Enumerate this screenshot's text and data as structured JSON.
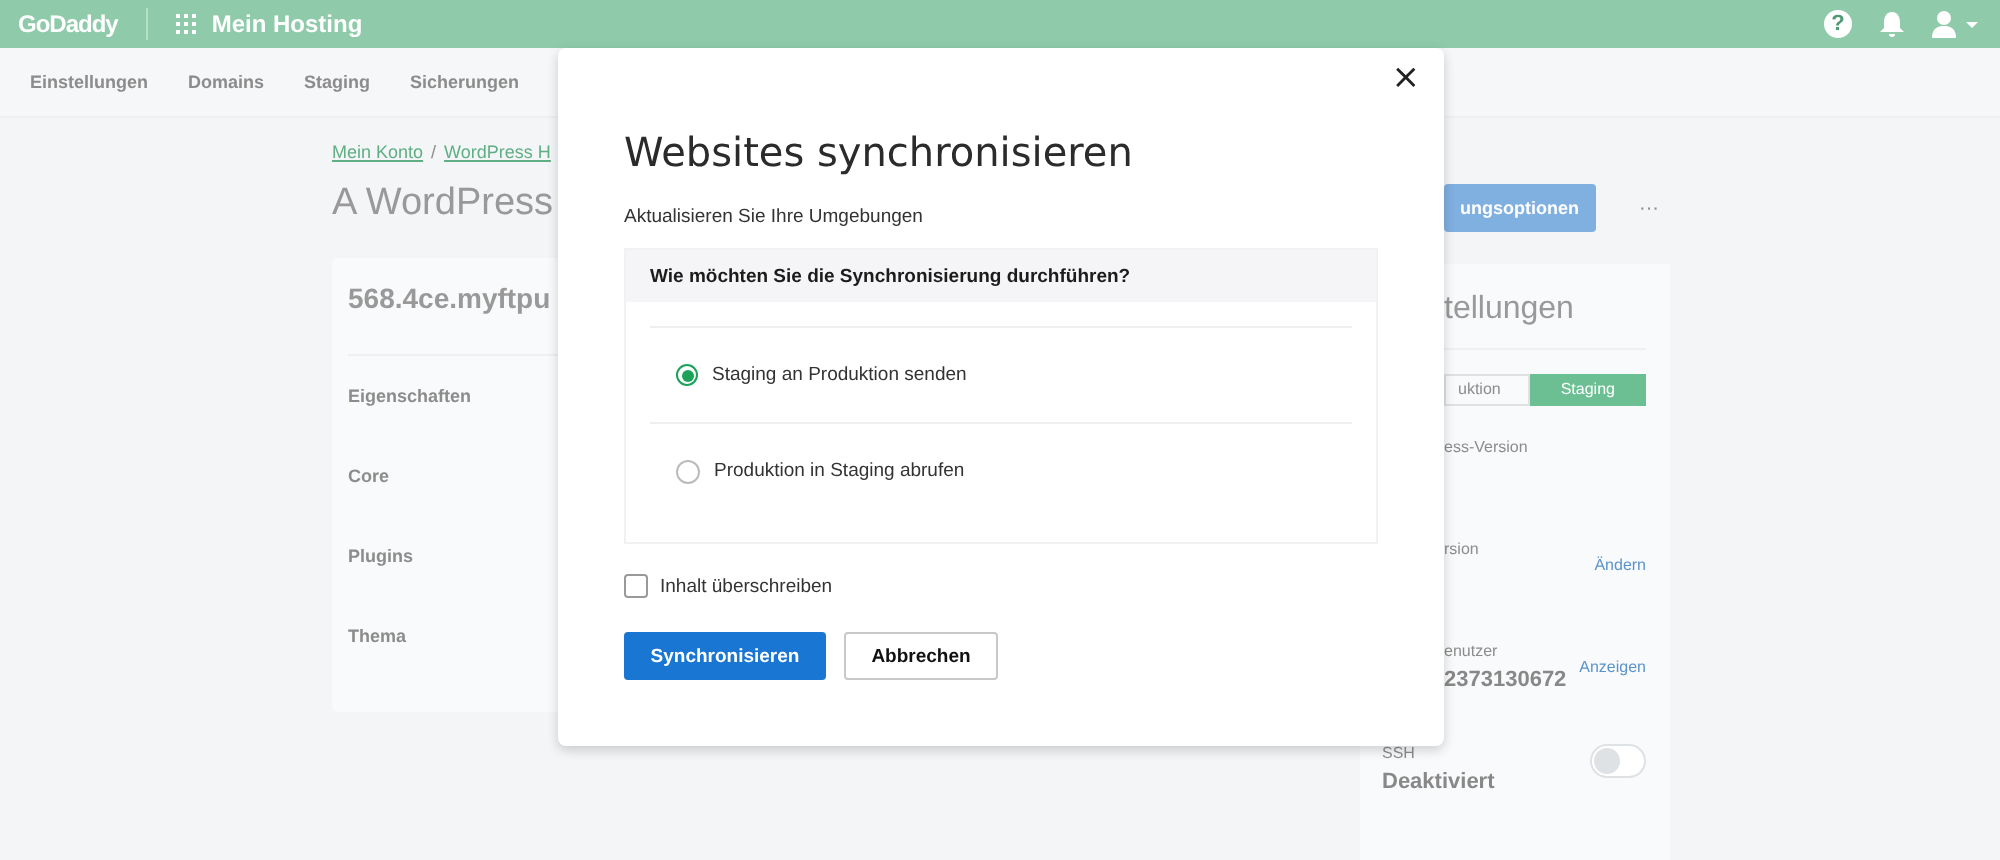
{
  "header": {
    "logo": "GoDaddy",
    "app_title": "Mein Hosting",
    "help": "?"
  },
  "nav": {
    "tabs": [
      {
        "label": "Einstellungen"
      },
      {
        "label": "Domains"
      },
      {
        "label": "Staging"
      },
      {
        "label": "Sicherungen"
      }
    ]
  },
  "breadcrumb": {
    "items": [
      "Mein Konto",
      "WordPress H"
    ],
    "separator": "/"
  },
  "page_title": "A WordPress",
  "site_card": {
    "domain": "568.4ce.myftpu",
    "rows": [
      "Eigenschaften",
      "Core",
      "Plugins",
      "Thema"
    ]
  },
  "side": {
    "action_button": "ungsoptionen",
    "more": "···",
    "panel": {
      "title": "tellungen",
      "env_toggle": [
        {
          "label": "uktion",
          "selected": false
        },
        {
          "label": "Staging",
          "selected": true
        }
      ],
      "fields": [
        {
          "kind": "text",
          "label": "ess-Version"
        },
        {
          "kind": "link",
          "label": "rsion",
          "link": "Ändern"
        },
        {
          "kind": "link",
          "label": "enutzer",
          "value": "2373130672",
          "link": "Anzeigen"
        },
        {
          "kind": "toggle",
          "label": "SSH",
          "value": "Deaktiviert",
          "on": false
        }
      ]
    }
  },
  "dialog": {
    "close": "×",
    "title": "Websites synchronisieren",
    "subtitle": "Aktualisieren Sie Ihre Umgebungen",
    "question": "Wie möchten Sie die Synchronisierung durchführen?",
    "options": [
      {
        "label": "Staging an Produktion senden",
        "selected": true
      },
      {
        "label": "Produktion in Staging abrufen",
        "selected": false
      }
    ],
    "checkbox": {
      "label": "Inhalt überschreiben",
      "checked": false
    },
    "buttons": [
      {
        "label": "Synchronisieren",
        "kind": "primary"
      },
      {
        "label": "Abbrechen",
        "kind": "secondary"
      }
    ]
  }
}
